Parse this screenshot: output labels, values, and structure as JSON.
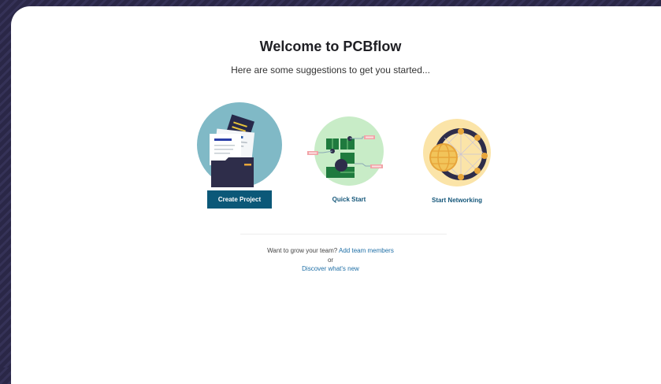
{
  "page": {
    "title": "Welcome to PCBflow",
    "subtitle": "Here are some suggestions to get you started..."
  },
  "cards": {
    "create_project": {
      "label": "Create Project",
      "icon": "folder-documents-illustration"
    },
    "quick_start": {
      "label": "Quick Start",
      "icon": "pcb-board-illustration"
    },
    "start_networking": {
      "label": "Start Networking",
      "icon": "globe-network-illustration"
    }
  },
  "footer": {
    "prompt": "Want to grow your team?",
    "add_members": "Add team members",
    "or": "or",
    "discover": "Discover what's new"
  },
  "colors": {
    "button_bg": "#0b5878",
    "link": "#1f6fa6",
    "background": "#2a2747"
  }
}
